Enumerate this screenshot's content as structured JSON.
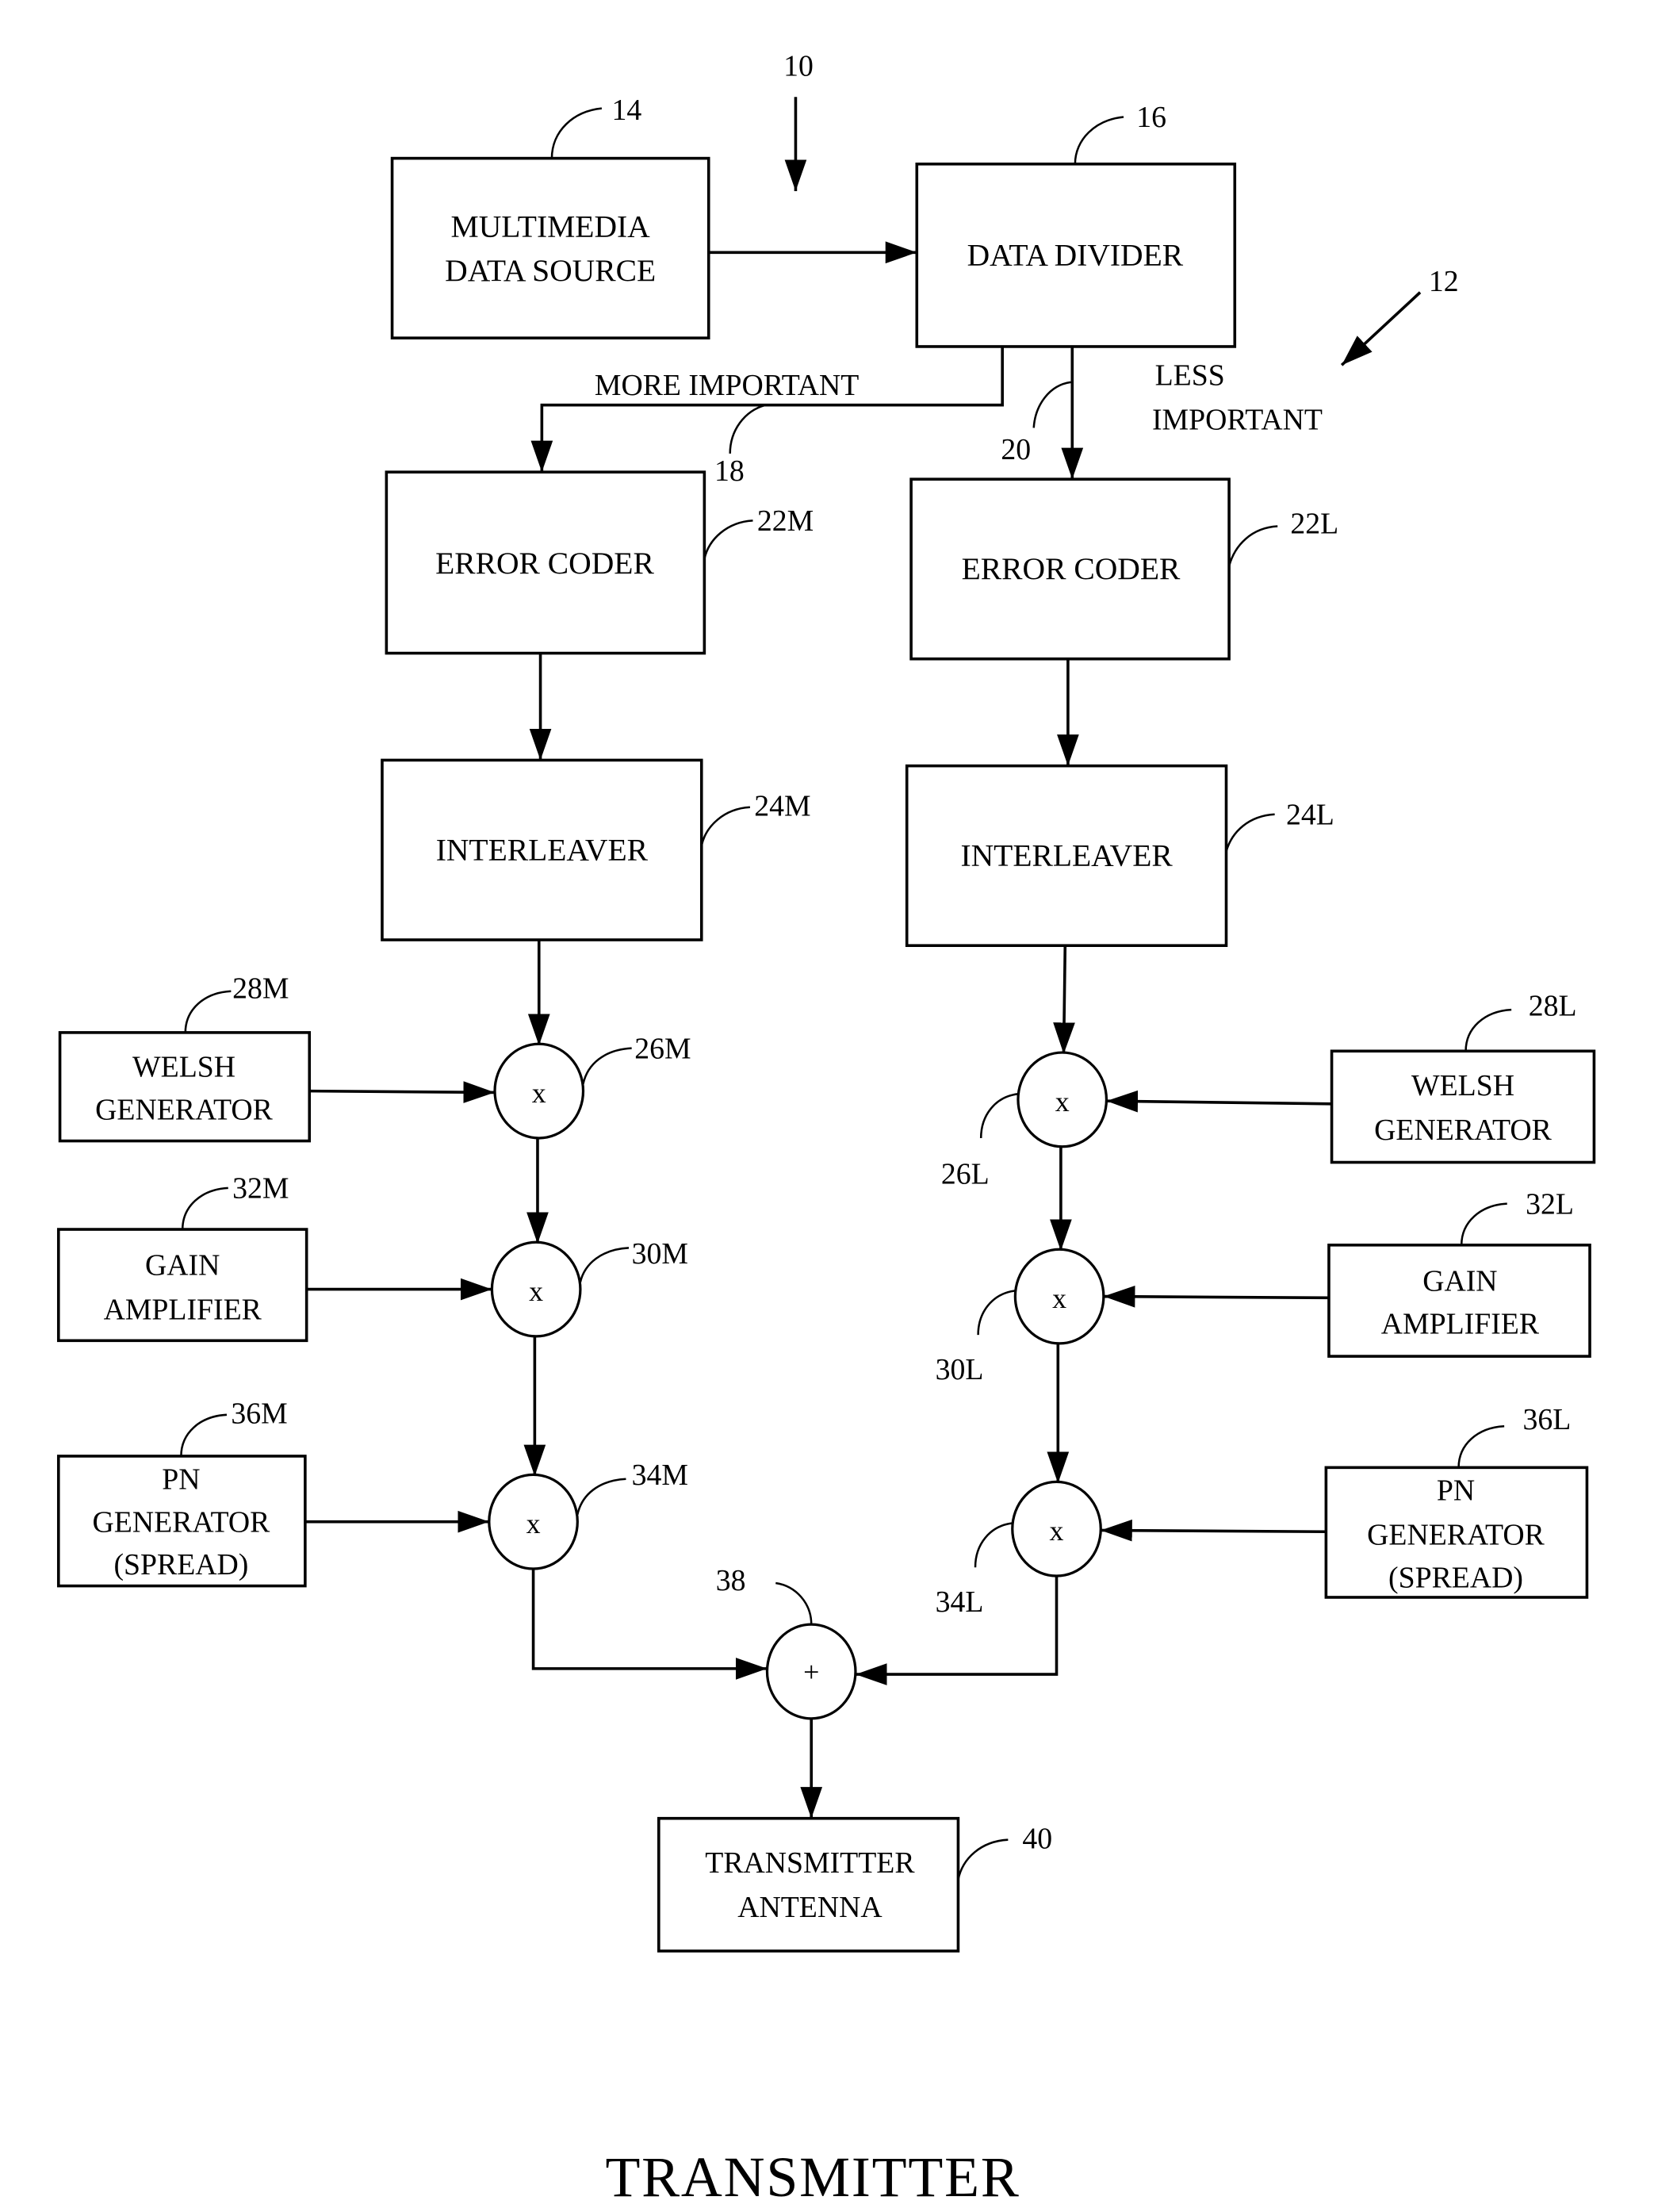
{
  "figure": {
    "title": "TRANSMITTER",
    "system_ref": "10",
    "transmitter_ref": "12"
  },
  "blocks": {
    "source": {
      "lines": [
        "MULTIMEDIA",
        "DATA SOURCE"
      ],
      "ref": "14"
    },
    "divider": {
      "lines": [
        "DATA DIVIDER"
      ],
      "ref": "16"
    },
    "error_coder_m": {
      "lines": [
        "ERROR CODER"
      ],
      "ref": "22M"
    },
    "error_coder_l": {
      "lines": [
        "ERROR CODER"
      ],
      "ref": "22L"
    },
    "interleaver_m": {
      "lines": [
        "INTERLEAVER"
      ],
      "ref": "24M"
    },
    "interleaver_l": {
      "lines": [
        "INTERLEAVER"
      ],
      "ref": "24L"
    },
    "welsh_m": {
      "lines": [
        "WELSH",
        "GENERATOR"
      ],
      "ref": "28M"
    },
    "welsh_l": {
      "lines": [
        "WELSH",
        "GENERATOR"
      ],
      "ref": "28L"
    },
    "gain_m": {
      "lines": [
        "GAIN",
        "AMPLIFIER"
      ],
      "ref": "32M"
    },
    "gain_l": {
      "lines": [
        "GAIN",
        "AMPLIFIER"
      ],
      "ref": "32L"
    },
    "pn_m": {
      "lines": [
        "PN",
        "GENERATOR",
        "(SPREAD)"
      ],
      "ref": "36M"
    },
    "pn_l": {
      "lines": [
        "PN",
        "GENERATOR",
        "(SPREAD)"
      ],
      "ref": "36L"
    },
    "antenna": {
      "lines": [
        "TRANSMITTER",
        "ANTENNA"
      ],
      "ref": "40"
    }
  },
  "nodes": {
    "mult_26m": {
      "symbol": "x",
      "ref": "26M"
    },
    "mult_30m": {
      "symbol": "x",
      "ref": "30M"
    },
    "mult_34m": {
      "symbol": "x",
      "ref": "34M"
    },
    "mult_26l": {
      "symbol": "x",
      "ref": "26L"
    },
    "mult_30l": {
      "symbol": "x",
      "ref": "30L"
    },
    "mult_34l": {
      "symbol": "x",
      "ref": "34L"
    },
    "sum_38": {
      "symbol": "+",
      "ref": "38"
    }
  },
  "paths": {
    "more_important": {
      "label": "MORE IMPORTANT",
      "ref": "18"
    },
    "less_important": {
      "label_lines": [
        "LESS",
        "IMPORTANT"
      ],
      "ref": "20"
    }
  }
}
